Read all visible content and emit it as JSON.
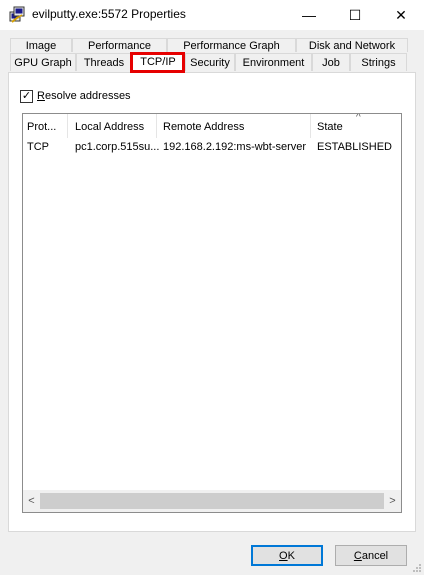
{
  "window": {
    "title": "evilputty.exe:5572 Properties",
    "icon": "putty-icon",
    "controls": {
      "minimize": "—",
      "maximize": "☐",
      "close": "✕"
    }
  },
  "tabs": {
    "row1": [
      "Image",
      "Performance",
      "Performance Graph",
      "Disk and Network"
    ],
    "row2": [
      "GPU Graph",
      "Threads",
      "TCP/IP",
      "Security",
      "Environment",
      "Job",
      "Strings"
    ],
    "active": "TCP/IP"
  },
  "resolve": {
    "label_prefix": "",
    "label_underlined": "R",
    "label_rest": "esolve addresses",
    "checked": true,
    "check_glyph": "✓"
  },
  "table": {
    "columns": [
      "Prot...",
      "Local Address",
      "Remote Address",
      "State"
    ],
    "sort_glyph": "^",
    "rows": [
      [
        "TCP",
        "pc1.corp.515su...",
        "192.168.2.192:ms-wbt-server",
        "ESTABLISHED"
      ]
    ]
  },
  "scrollbar": {
    "left_glyph": "<",
    "right_glyph": ">"
  },
  "buttons": {
    "ok_u": "O",
    "ok_rest": "K",
    "cancel_u": "C",
    "cancel_rest": "ancel"
  },
  "colors": {
    "highlight": "#e60000",
    "accent": "#0078d7"
  }
}
